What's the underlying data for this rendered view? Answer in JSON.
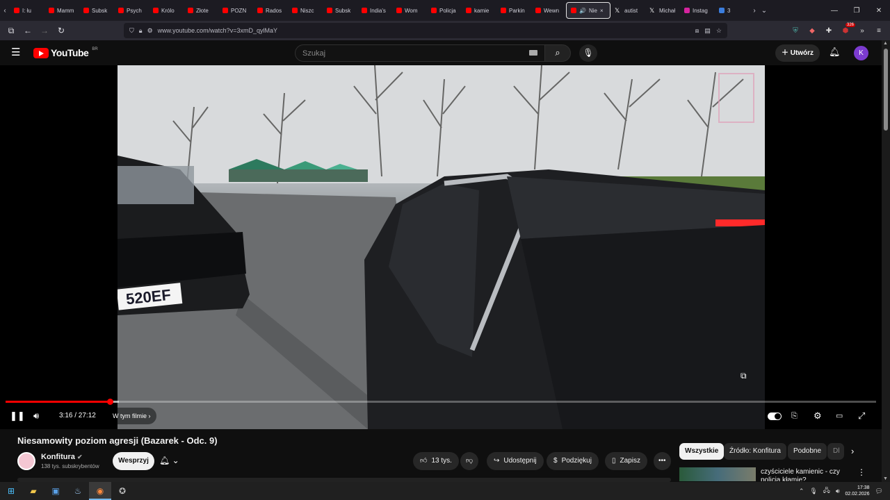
{
  "browser": {
    "tabs": [
      {
        "label": "I: łu",
        "fav": "youtube"
      },
      {
        "label": "Mamm",
        "fav": "youtube"
      },
      {
        "label": "Subsk",
        "fav": "youtube"
      },
      {
        "label": "Psych",
        "fav": "youtube"
      },
      {
        "label": "Królo",
        "fav": "youtube"
      },
      {
        "label": "Złote",
        "fav": "youtube"
      },
      {
        "label": "POZN",
        "fav": "youtube"
      },
      {
        "label": "Rados",
        "fav": "youtube"
      },
      {
        "label": "Niszc",
        "fav": "youtube"
      },
      {
        "label": "Subsk",
        "fav": "youtube"
      },
      {
        "label": "India's",
        "fav": "youtube"
      },
      {
        "label": "Wom",
        "fav": "youtube"
      },
      {
        "label": "Policja",
        "fav": "youtube"
      },
      {
        "label": "kamie",
        "fav": "youtube"
      },
      {
        "label": "Parkin",
        "fav": "youtube"
      },
      {
        "label": "Wewn",
        "fav": "youtube"
      }
    ],
    "active_tab": {
      "label": "Nie",
      "close": "×"
    },
    "extra_tabs": [
      {
        "label": "autist",
        "fav": "x"
      },
      {
        "label": "Michał",
        "fav": "x"
      },
      {
        "label": "Instag",
        "fav": "instagram"
      },
      {
        "label": "3",
        "fav": "multi"
      }
    ],
    "url": "www.youtube.com/watch?v=3xmD_qylMaY",
    "extension_badge": "326"
  },
  "youtube": {
    "logo_text": "YouTube",
    "logo_region": "BR",
    "search_placeholder": "Szukaj",
    "create_label": "Utwórz",
    "avatar_letter": "K"
  },
  "player": {
    "current_time": "3:16",
    "duration": "27:12",
    "time_display": "3:16 / 27:12",
    "chapter_label": "W tym filmie",
    "progress_fraction": 0.12,
    "buffered_fraction": 0.13
  },
  "video": {
    "title": "Niesamowity poziom agresji (Bazarek - Odc. 9)",
    "plate_text": "520EF",
    "channel_name": "Konfitura",
    "subscribers": "138 tys. subskrybentów",
    "support_label": "Wesprzyj",
    "likes": "13 tys.",
    "share_label": "Udostępnij",
    "thanks_label": "Podziękuj",
    "save_label": "Zapisz"
  },
  "chips": [
    "Wszystkie",
    "Źródło: Konfitura",
    "Podobne",
    "Dl"
  ],
  "recommendation": {
    "title": "czyściciele kamienic - czy policja kłamie?"
  },
  "taskbar": {
    "time": "17:38",
    "date": "02.02.2026"
  },
  "colors": {
    "accent_red": "#ff0000",
    "avatar_bg": "#7c3bd0",
    "page_bg": "#0f0f0f"
  }
}
